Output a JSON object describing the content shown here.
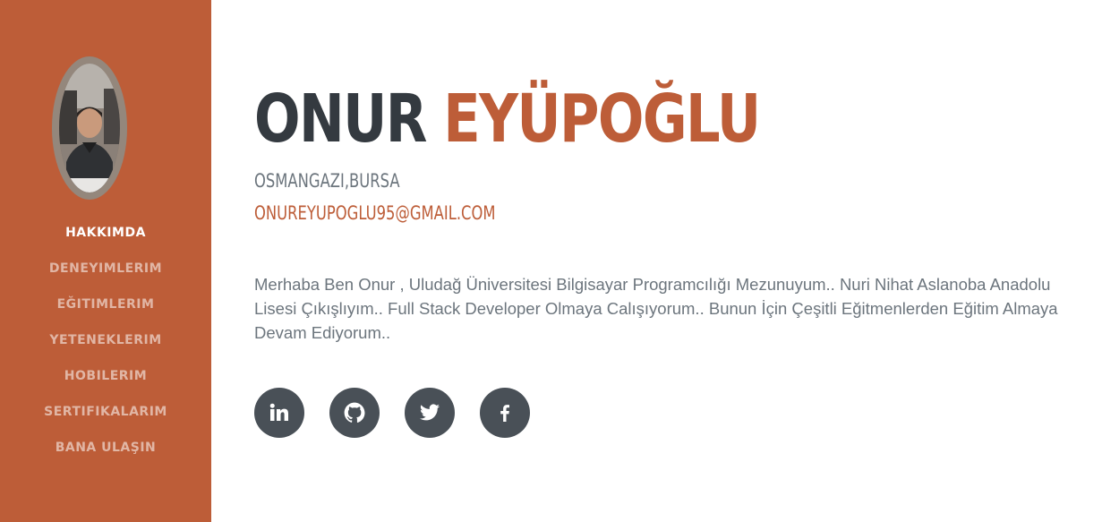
{
  "profile": {
    "first_name": "ONUR",
    "last_name": "EYÜPOĞLU",
    "location": "OSMANGAZI,BURSA",
    "email": "ONUREYUPOGLU95@GMAIL.COM",
    "about": "Merhaba Ben Onur , Uludağ Üniversitesi Bilgisayar Programcılığı Mezunuyum.. Nuri Nihat Aslanoba Anadolu Lisesi Çıkışlıyım.. Full Stack Developer Olmaya Calışıyorum.. Bunun İçin Çeşitli Eğitmenlerden Eğitim Almaya Devam Ediyorum.."
  },
  "sidebar": {
    "items": [
      {
        "label": "HAKKIMDA",
        "active": true
      },
      {
        "label": "DENEYIMLERIM",
        "active": false
      },
      {
        "label": "EĞITIMLERIM",
        "active": false
      },
      {
        "label": "YETENEKLERIM",
        "active": false
      },
      {
        "label": "HOBILERIM",
        "active": false
      },
      {
        "label": "SERTIFIKALARIM",
        "active": false
      },
      {
        "label": "BANA ULAŞIN",
        "active": false
      }
    ]
  },
  "social": [
    {
      "icon": "linkedin-icon"
    },
    {
      "icon": "github-icon"
    },
    {
      "icon": "twitter-icon"
    },
    {
      "icon": "facebook-icon"
    }
  ],
  "colors": {
    "sidebar": "#bd5d38",
    "accent": "#bd5d38",
    "heading": "#343a40",
    "text": "#6c757d",
    "social_bg": "#495057"
  }
}
